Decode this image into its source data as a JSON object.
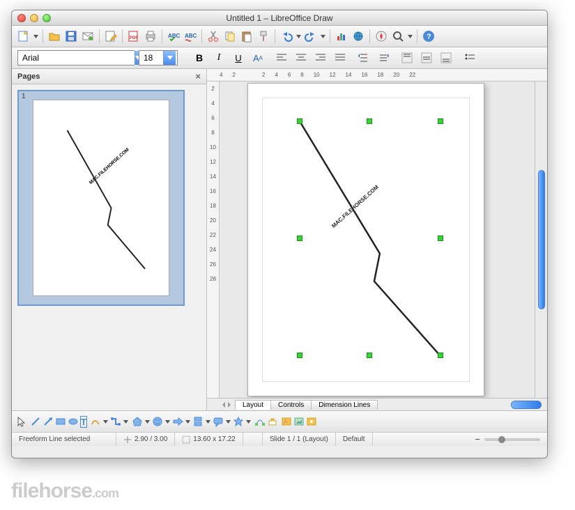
{
  "window": {
    "title": "Untitled 1 – LibreOffice Draw"
  },
  "font": {
    "name": "Arial",
    "size": "18"
  },
  "pages_panel": {
    "title": "Pages",
    "pages": [
      {
        "num": "1"
      }
    ]
  },
  "ruler_h": [
    "4",
    "2",
    "2",
    "4",
    "6",
    "8",
    "10",
    "12",
    "14",
    "16",
    "18",
    "20",
    "22"
  ],
  "ruler_v": [
    "2",
    "4",
    "6",
    "8",
    "10",
    "12",
    "14",
    "16",
    "18",
    "20",
    "22",
    "24",
    "26",
    "28"
  ],
  "canvas": {
    "watermark_text": "MAC.FILEHORSE.COM"
  },
  "tabs": {
    "layout": "Layout",
    "controls": "Controls",
    "dimension": "Dimension Lines"
  },
  "status": {
    "selection": "Freeform Line selected",
    "pos": "2.90 / 3.00",
    "size": "13.60 x 17.22",
    "slide": "Slide 1 / 1 (Layout)",
    "mode": "Default"
  },
  "footer_watermark": {
    "brand": "filehorse",
    "tld": ".com"
  }
}
